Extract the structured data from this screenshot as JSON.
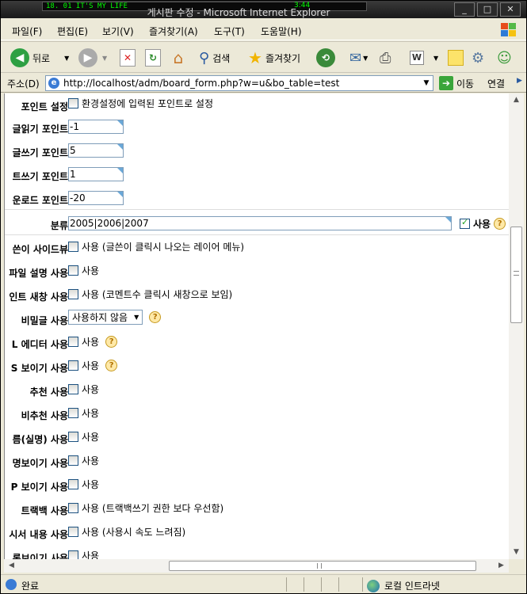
{
  "window": {
    "title": "게시판 수정 - Microsoft Internet Explorer",
    "winamp_track": "18. 01 IT'S MY LIFE",
    "winamp_time": "3:44"
  },
  "menu": [
    "파일(F)",
    "편집(E)",
    "보기(V)",
    "즐겨찾기(A)",
    "도구(T)",
    "도움말(H)"
  ],
  "toolbar": {
    "back": "뒤로",
    "search": "검색",
    "favorites": "즐겨찾기"
  },
  "address": {
    "label": "주소(D)",
    "url": "http://localhost/adm/board_form.php?w=u&bo_table=test",
    "go": "이동",
    "links": "연결"
  },
  "form": {
    "point_setting_label": "포인트 설정",
    "point_setting_cb": "환경설정에 입력된 포인트로 설정",
    "read_point_label": "글읽기 포인트",
    "read_point_value": "-1",
    "write_point_label": "글쓰기 포인트",
    "write_point_value": "5",
    "comment_point_label": "트쓰기 포인트",
    "comment_point_value": "1",
    "download_point_label": "운로드 포인트",
    "download_point_value": "-20",
    "category_label": "분류",
    "category_value": "2005|2006|2007",
    "category_use": "사용",
    "sideview_label": "쓴이 사이드뷰",
    "sideview_text": "사용 (글쓴이 클릭시 나오는 레이어 메뉴)",
    "filedesc_label": "파일 설명 사용",
    "filedesc_text": "사용",
    "comment_newwin_label": "인트 새창 사용",
    "comment_newwin_text": "사용 (코멘트수 클릭시 새창으로 보임)",
    "secret_label": "비밀글 사용",
    "secret_select": "사용하지 않음",
    "editor_label": "L 에디터 사용",
    "editor_text": "사용",
    "ss_label": "S 보이기 사용",
    "ss_text": "사용",
    "good_label": "추천 사용",
    "good_text": "사용",
    "nogood_label": "비추천 사용",
    "nogood_text": "사용",
    "realname_label": "름(실명) 사용",
    "realname_text": "사용",
    "signview_label": "명보이기 사용",
    "signview_text": "사용",
    "ipview_label": "P 보이기 사용",
    "ipview_text": "사용",
    "trackback_label": "트랙백 사용",
    "trackback_text": "사용 (트랙백쓰기 권한 보다 우선함)",
    "listview_label": "시서 내용 사용",
    "listview_text": "사용 (사용시 속도 느려짐)",
    "listshow_label": "록보이기 사용",
    "listshow_text": "사용"
  },
  "status": {
    "text": "완료",
    "zone": "로컬 인트라넷"
  },
  "colors": {
    "window_bg": "#ece9d8",
    "title_bg": "#2a2a2a",
    "input_border": "#7f9db9"
  }
}
